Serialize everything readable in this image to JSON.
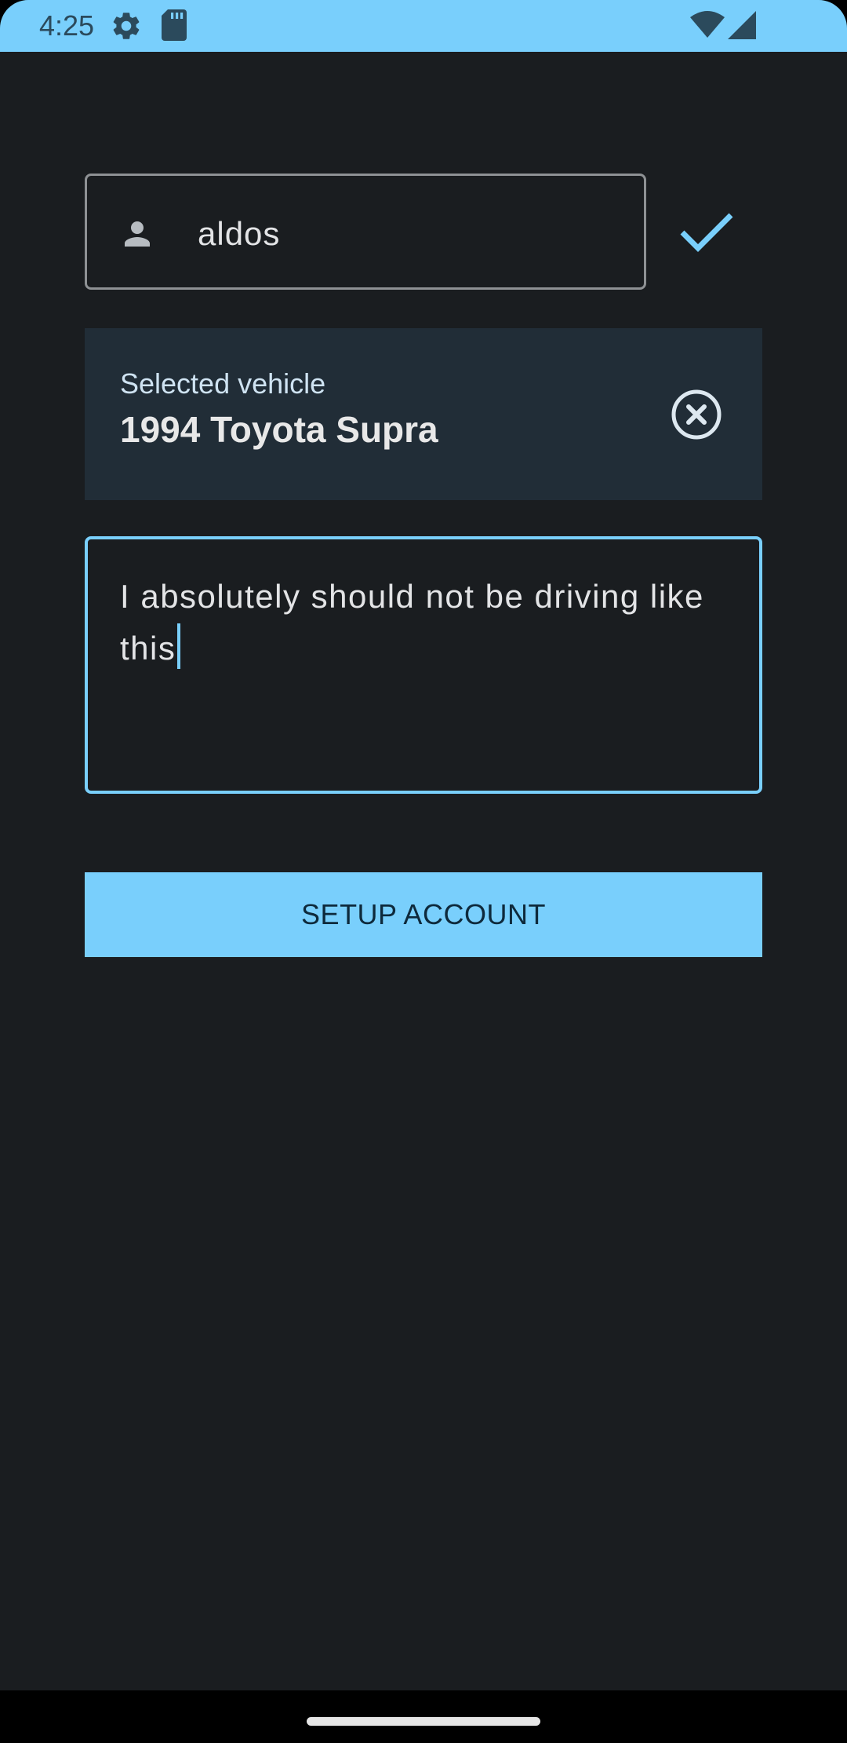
{
  "status_bar": {
    "time": "4:25",
    "icons": [
      "settings-icon",
      "sd-card-icon",
      "wifi-icon",
      "signal-icon"
    ],
    "background_color": "#79cffc"
  },
  "form": {
    "username": {
      "value": "aldos",
      "leading_icon": "person-icon",
      "validated_icon": "check-icon"
    },
    "vehicle": {
      "label": "Selected vehicle",
      "name": "1994 Toyota Supra",
      "clear_icon": "close-circle-icon"
    },
    "notes": {
      "value": "I absolutely should not be driving like this",
      "focused": true
    },
    "setup_button_label": "SETUP ACCOUNT"
  },
  "colors": {
    "accent": "#79cffc",
    "background": "#1a1d20",
    "card": "#212d37"
  }
}
